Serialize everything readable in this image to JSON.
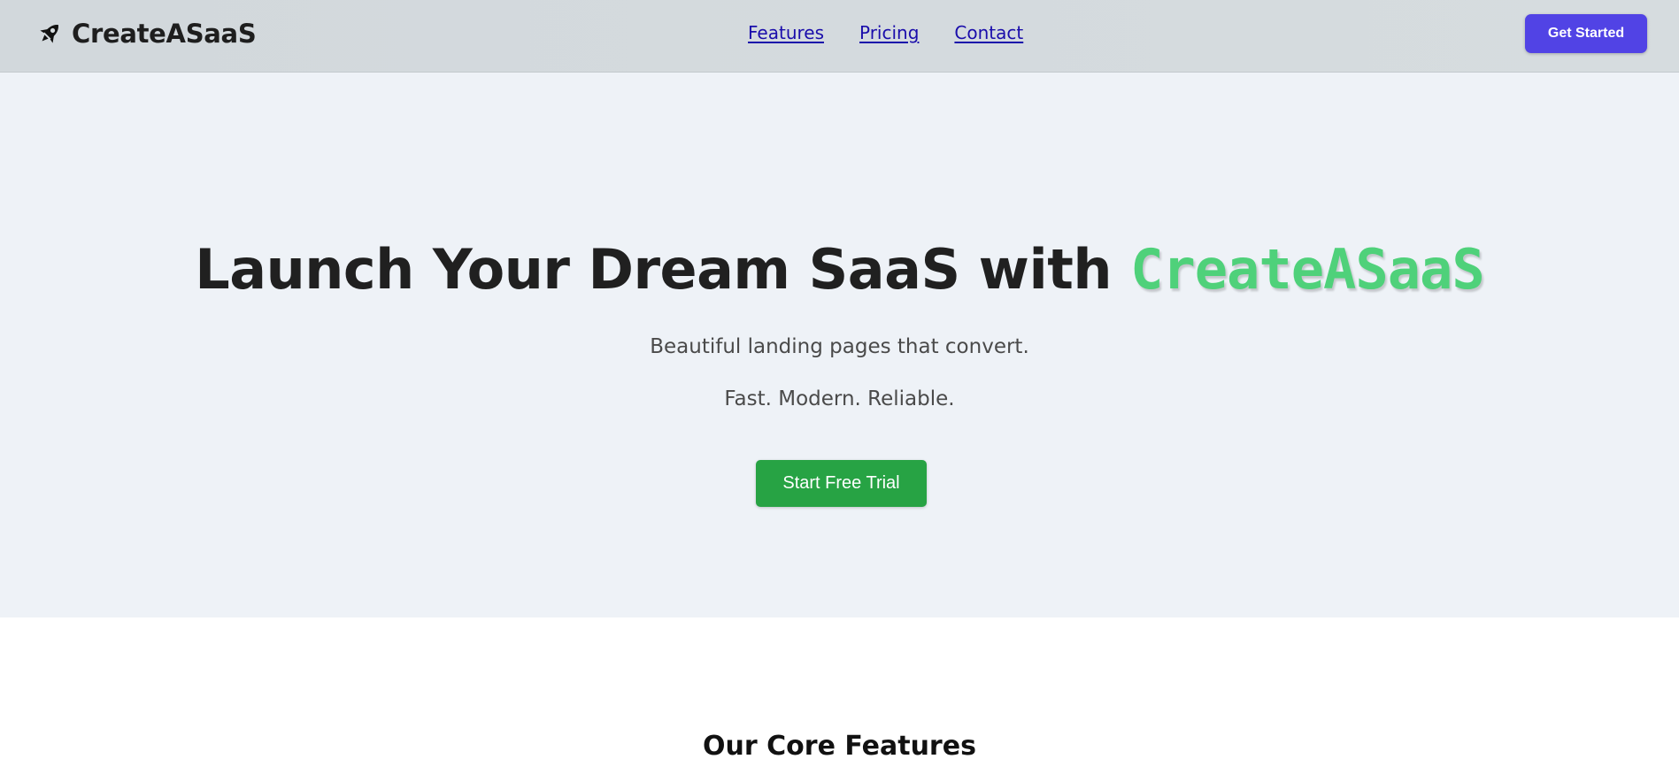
{
  "navbar": {
    "brand": {
      "icon": "rocket-icon",
      "name": "CreateASaaS"
    },
    "links": [
      {
        "label": "Features"
      },
      {
        "label": "Pricing"
      },
      {
        "label": "Contact"
      }
    ],
    "cta_label": "Get Started"
  },
  "hero": {
    "title_prefix": "Launch Your Dream SaaS with ",
    "title_accent": "CreateASaaS",
    "subtitle": "Beautiful landing pages that convert.",
    "tagline": "Fast. Modern. Reliable.",
    "cta_label": "Start Free Trial"
  },
  "features": {
    "title": "Our Core Features"
  },
  "colors": {
    "navbar_bg": "#d4dadd",
    "hero_bg": "#eef2f7",
    "primary_button": "#5143e5",
    "trial_button": "#27a344",
    "accent_text": "#4fd17a",
    "link": "#1a0dab"
  }
}
